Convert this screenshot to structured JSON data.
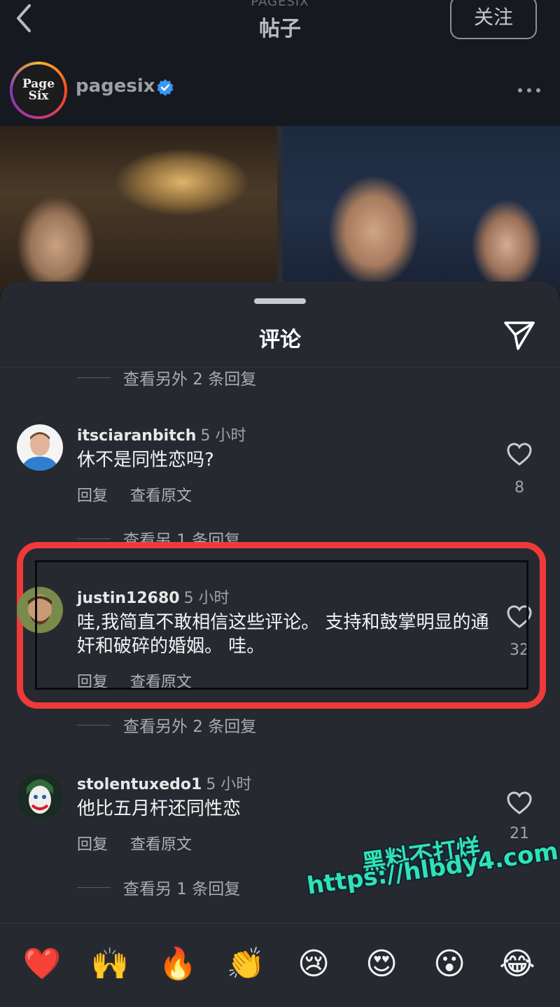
{
  "topbar": {
    "subtitle": "PAGESIX",
    "title": "帖子",
    "follow_label": "关注"
  },
  "post": {
    "username": "pagesix",
    "logo_line1": "Page",
    "logo_line2": "Six",
    "verified": true
  },
  "sheet": {
    "title": "评论"
  },
  "comments": [
    {
      "view_replies_above": "查看另外 2 条回复",
      "username": "itsciaranbitch",
      "time": "5 小时",
      "text": "休不是同性恋吗?",
      "reply_label": "回复",
      "translate_label": "查看原文",
      "likes": "8"
    },
    {
      "view_replies_above": "查看另 1 条回复",
      "username": "justin12680",
      "time": "5 小时",
      "text": "哇,我简直不敢相信这些评论。 支持和鼓掌明显的通奸和破碎的婚姻。 哇。",
      "reply_label": "回复",
      "translate_label": "查看原文",
      "likes": "32"
    },
    {
      "view_replies_above": "查看另外 2 条回复",
      "username": "stolentuxedo1",
      "time": "5 小时",
      "text": "他比五月杆还同性恋",
      "reply_label": "回复",
      "translate_label": "查看原文",
      "likes": "21",
      "view_replies_below": "查看另 1 条回复"
    }
  ],
  "emoji_bar": [
    "❤️",
    "🙌",
    "🔥",
    "👏",
    "😢",
    "😍",
    "😮",
    "😂"
  ],
  "watermark": {
    "line1": "黑料不打烊",
    "line2": "https://hlbdy4.com"
  },
  "colors": {
    "highlight": "#f03a3a",
    "verified_blue": "#3897f0",
    "watermark": "#2fe3b3"
  }
}
